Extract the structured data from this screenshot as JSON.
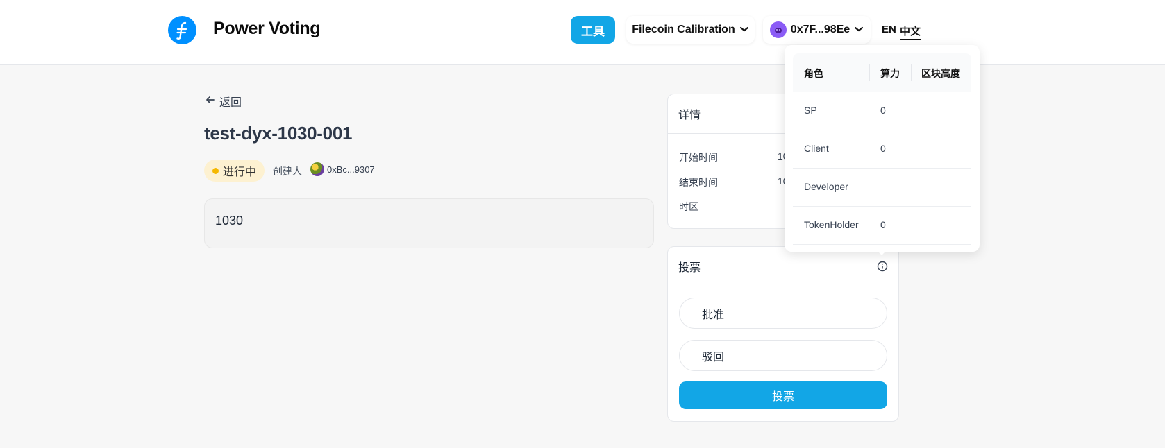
{
  "header": {
    "app_title": "Power Voting",
    "tools_label": "工具",
    "network_label": "Filecoin Calibration",
    "account_label": "0x7F...98Ee",
    "lang_en": "EN",
    "lang_zh": "中文"
  },
  "proposal": {
    "back_label": "返回",
    "title": "test-dyx-1030-001",
    "status": "进行中",
    "creator_label": "创建人",
    "creator_address": "0xBc...9307",
    "description": "1030"
  },
  "details": {
    "header": "详情",
    "rows": [
      {
        "label": "开始时间",
        "value": "10"
      },
      {
        "label": "结束时间",
        "value": "10"
      },
      {
        "label": "时区",
        "value": ""
      }
    ]
  },
  "vote": {
    "header": "投票",
    "options": [
      "批准",
      "驳回"
    ],
    "submit_label": "投票"
  },
  "power_popover": {
    "columns": [
      "角色",
      "算力",
      "区块高度"
    ],
    "rows": [
      {
        "role": "SP",
        "power": "0"
      },
      {
        "role": "Client",
        "power": "0"
      },
      {
        "role": "Developer",
        "power": ""
      },
      {
        "role": "TokenHolder",
        "power": "0"
      }
    ]
  },
  "colors": {
    "accent": "#12a6e6",
    "logo": "#0090ff",
    "status_bg": "#fdf1d1",
    "status_dot": "#f5b800"
  },
  "icons": [
    "filecoin-logo-icon",
    "chevron-down-icon",
    "account-avatar-icon",
    "back-arrow-icon",
    "info-icon"
  ]
}
